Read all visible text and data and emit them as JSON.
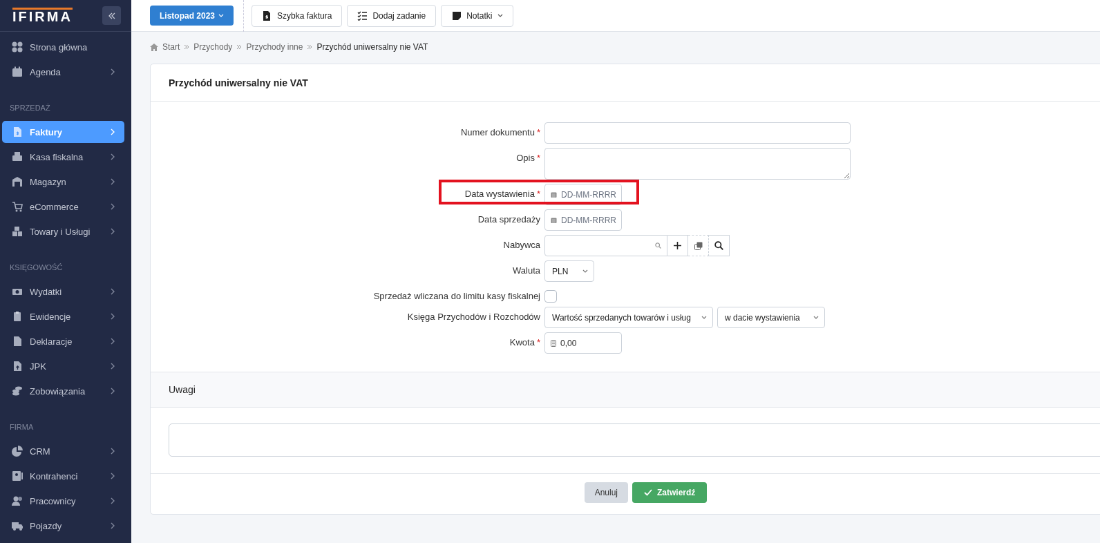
{
  "logo": "IFIRMA",
  "sidebar": {
    "sections": [
      {
        "items": [
          {
            "label": "Strona główna",
            "selected": false,
            "expandable": false
          },
          {
            "label": "Agenda",
            "selected": false,
            "expandable": true
          }
        ]
      },
      {
        "heading": "SPRZEDAŻ",
        "items": [
          {
            "label": "Faktury",
            "selected": true,
            "expandable": true
          },
          {
            "label": "Kasa fiskalna",
            "selected": false,
            "expandable": true
          },
          {
            "label": "Magazyn",
            "selected": false,
            "expandable": true
          },
          {
            "label": "eCommerce",
            "selected": false,
            "expandable": true
          },
          {
            "label": "Towary i Usługi",
            "selected": false,
            "expandable": true
          }
        ]
      },
      {
        "heading": "KSIĘGOWOŚĆ",
        "items": [
          {
            "label": "Wydatki",
            "selected": false,
            "expandable": true
          },
          {
            "label": "Ewidencje",
            "selected": false,
            "expandable": true
          },
          {
            "label": "Deklaracje",
            "selected": false,
            "expandable": true
          },
          {
            "label": "JPK",
            "selected": false,
            "expandable": true
          },
          {
            "label": "Zobowiązania",
            "selected": false,
            "expandable": true
          }
        ]
      },
      {
        "heading": "FIRMA",
        "items": [
          {
            "label": "CRM",
            "selected": false,
            "expandable": true
          },
          {
            "label": "Kontrahenci",
            "selected": false,
            "expandable": true
          },
          {
            "label": "Pracownicy",
            "selected": false,
            "expandable": true
          },
          {
            "label": "Pojazdy",
            "selected": false,
            "expandable": true
          }
        ]
      }
    ]
  },
  "period_button": {
    "label": "Listopad 2023"
  },
  "toolbar": [
    {
      "label": "Szybka faktura",
      "dropdown": false
    },
    {
      "label": "Dodaj zadanie",
      "dropdown": false
    },
    {
      "label": "Notatki",
      "dropdown": true
    }
  ],
  "breadcrumb": [
    {
      "label": "Start",
      "current": false
    },
    {
      "label": "Przychody",
      "current": false
    },
    {
      "label": "Przychody inne",
      "current": false
    },
    {
      "label": "Przychód uniwersalny nie VAT",
      "current": true
    }
  ],
  "form": {
    "title": "Przychód uniwersalny nie VAT",
    "rows": [
      {
        "kind": "text",
        "label": "Numer dokumentu",
        "required_mark": "*",
        "highlighted": false
      },
      {
        "kind": "textarea",
        "label": "Opis",
        "required_mark": "*",
        "highlighted": false
      },
      {
        "kind": "date",
        "label": "Data wystawienia",
        "required_mark": "*",
        "highlighted": true,
        "placeholder": "DD-MM-RRRR"
      },
      {
        "kind": "date",
        "label": "Data sprzedaży",
        "highlighted": false,
        "placeholder": "DD-MM-RRRR"
      },
      {
        "kind": "search",
        "label": "Nabywca",
        "highlighted": false
      },
      {
        "kind": "select",
        "label": "Waluta",
        "highlighted": false,
        "value": "PLN"
      },
      {
        "kind": "checkbox",
        "label": "Sprzedaż wliczana do limitu kasy fiskalnej",
        "highlighted": false,
        "checked": false
      },
      {
        "kind": "selectpair",
        "label": "Księga Przychodów i Rozchodów",
        "highlighted": false,
        "value": "Wartość sprzedanych towarów i usług",
        "value_2": "w dacie wystawienia"
      },
      {
        "kind": "amount",
        "label": "Kwota",
        "required_mark": "*",
        "highlighted": false,
        "value": "0,00"
      }
    ]
  },
  "notes": {
    "title": "Uwagi"
  },
  "buttons": [
    {
      "kind": "cancel",
      "label": "Anuluj"
    },
    {
      "kind": "confirm",
      "label": "Zatwierdź"
    }
  ]
}
